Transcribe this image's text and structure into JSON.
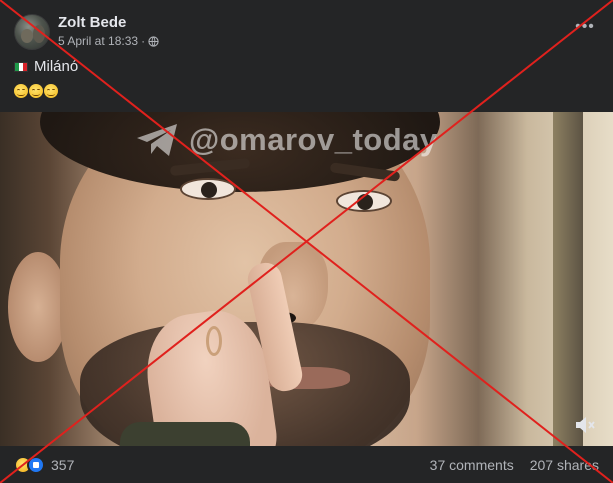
{
  "post": {
    "author": "Zolt Bede",
    "timestamp": "5 April at 18:33",
    "audience_icon": "globe-icon",
    "more_label": "•••",
    "location_text": "Milánó",
    "flag": "italy-flag",
    "emojis": [
      "grinning-face",
      "grinning-face",
      "grinning-face"
    ]
  },
  "media": {
    "watermark": "@omarov_today",
    "watermark_icon": "telegram-icon",
    "volume_icon": "volume-muted-icon"
  },
  "stats": {
    "reaction_icons": [
      "haha-icon",
      "like-icon"
    ],
    "reaction_count": "357",
    "comments": "37 comments",
    "shares": "207 shares"
  },
  "overlay": {
    "cross_color": "#e0211d"
  }
}
